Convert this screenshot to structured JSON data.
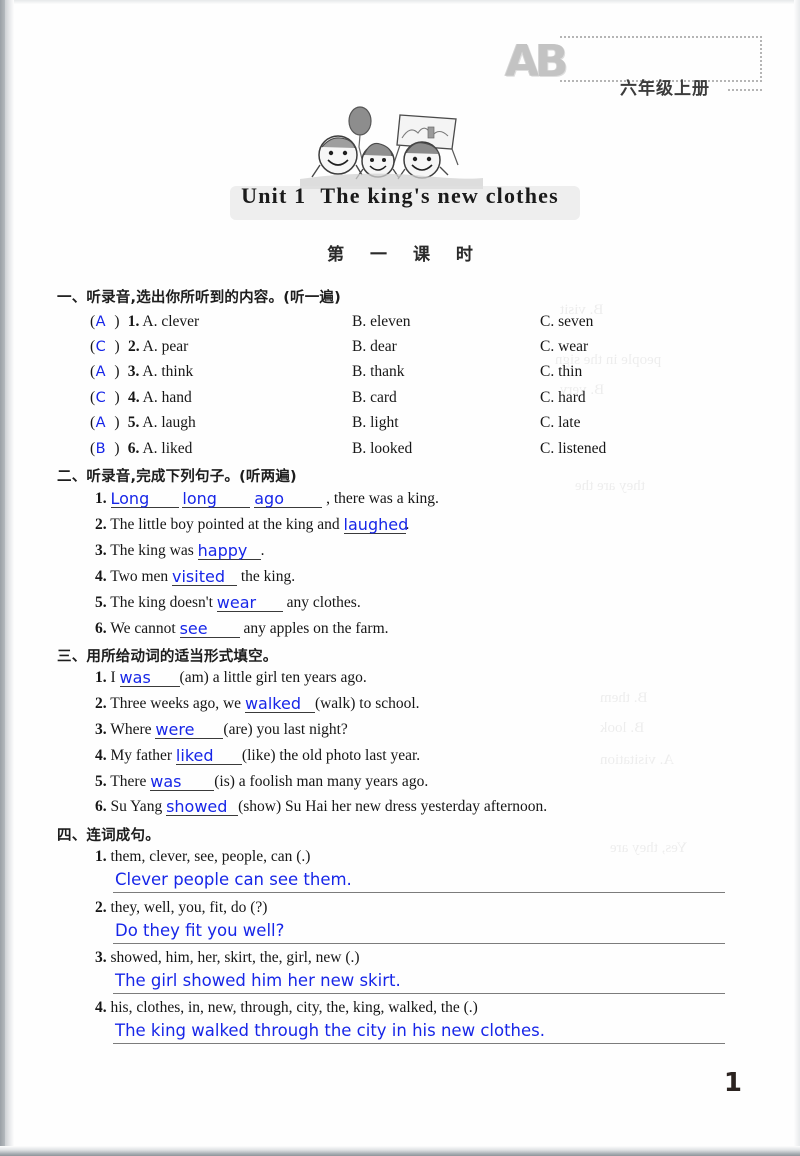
{
  "header": {
    "logo": "AB",
    "grade": "六年级上册"
  },
  "unit": {
    "title_prefix": "Unit 1",
    "title_main": "The king's new clothes",
    "lesson": "第 一 课 时"
  },
  "sections": [
    {
      "id": "section-one",
      "heading": "一、听录音,选出你所听到的内容。(听一遍)",
      "type": "multiple-choice",
      "items": [
        {
          "num": "1",
          "answer": "A",
          "a": "A. clever",
          "b": "B. eleven",
          "c": "C. seven"
        },
        {
          "num": "2",
          "answer": "C",
          "a": "A. pear",
          "b": "B. dear",
          "c": "C. wear"
        },
        {
          "num": "3",
          "answer": "A",
          "a": "A. think",
          "b": "B. thank",
          "c": "C. thin"
        },
        {
          "num": "4",
          "answer": "C",
          "a": "A. hand",
          "b": "B. card",
          "c": "C. hard"
        },
        {
          "num": "5",
          "answer": "A",
          "a": "A. laugh",
          "b": "B. light",
          "c": "C. late"
        },
        {
          "num": "6",
          "answer": "B",
          "a": "A. liked",
          "b": "B. looked",
          "c": "C. listened"
        }
      ]
    },
    {
      "id": "section-two",
      "heading": "二、听录音,完成下列句子。(听两遍)",
      "type": "fill-blank",
      "items": [
        {
          "num": "1",
          "pre": "",
          "answers": [
            "Long",
            "long",
            "ago"
          ],
          "post": ", there was a king."
        },
        {
          "num": "2",
          "pre": "The little boy pointed at the king and ",
          "answers": [
            "laughed"
          ],
          "post": "."
        },
        {
          "num": "3",
          "pre": "The king was ",
          "answers": [
            "happy"
          ],
          "post": "."
        },
        {
          "num": "4",
          "pre": "Two men ",
          "answers": [
            "visited"
          ],
          "post": " the king."
        },
        {
          "num": "5",
          "pre": "The king doesn't ",
          "answers": [
            "wear"
          ],
          "post": " any clothes."
        },
        {
          "num": "6",
          "pre": "We cannot ",
          "answers": [
            "see"
          ],
          "post": " any apples on the farm."
        }
      ]
    },
    {
      "id": "section-three",
      "heading": "三、用所给动词的适当形式填空。",
      "type": "verb-form",
      "items": [
        {
          "num": "1",
          "pre": "I ",
          "answer": "was",
          "hint": "(am)",
          "post": " a little girl ten years ago."
        },
        {
          "num": "2",
          "pre": "Three weeks ago, we ",
          "answer": "walked",
          "hint": "(walk)",
          "post": " to school."
        },
        {
          "num": "3",
          "pre": "Where ",
          "answer": "were",
          "hint": "(are)",
          "post": " you last night?"
        },
        {
          "num": "4",
          "pre": "My father ",
          "answer": "liked",
          "hint": "(like)",
          "post": " the old photo last year."
        },
        {
          "num": "5",
          "pre": "There ",
          "answer": "was",
          "hint": "(is)",
          "post": " a foolish man many years ago."
        },
        {
          "num": "6",
          "pre": "Su Yang ",
          "answer": "showed",
          "hint": "(show)",
          "post": " Su Hai her new dress yesterday afternoon."
        }
      ]
    },
    {
      "id": "section-four",
      "heading": "四、连词成句。",
      "type": "word-order",
      "items": [
        {
          "num": "1",
          "words": "them, clever, see, people, can (.)",
          "answer": "Clever people can see them."
        },
        {
          "num": "2",
          "words": "they, well, you, fit, do (?)",
          "answer": "Do they fit you well?"
        },
        {
          "num": "3",
          "words": "showed, him, her, skirt, the, girl, new (.)",
          "answer": "The girl showed him her new skirt."
        },
        {
          "num": "4",
          "words": "his, clothes, in, new, through, city, the, king, walked, the (.)",
          "answer": "The king walked through the city in his new clothes."
        }
      ]
    }
  ],
  "page_number": "1",
  "colors": {
    "answer_blue": "#1726e8",
    "text_black": "#161616"
  }
}
